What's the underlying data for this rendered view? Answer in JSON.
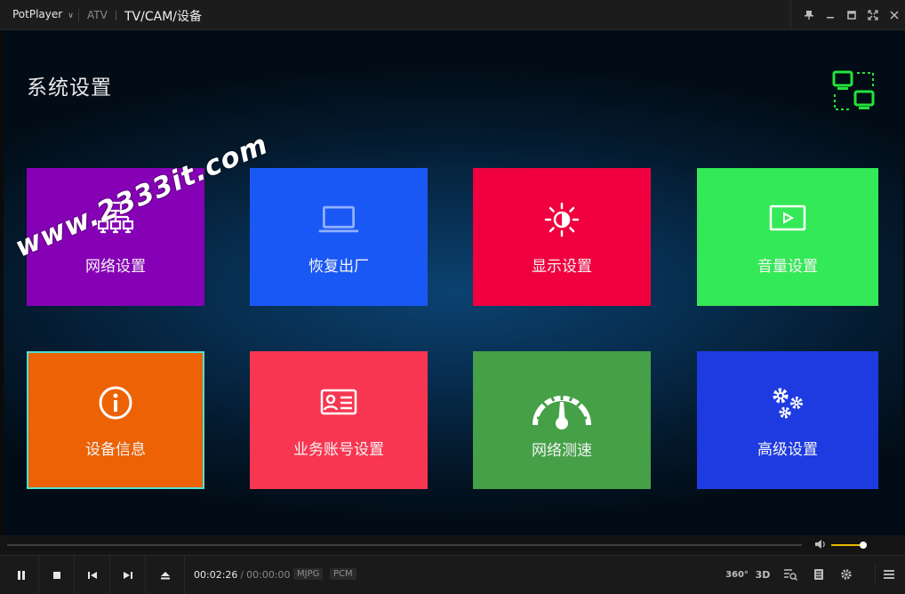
{
  "titlebar": {
    "app_menu": "PotPlayer",
    "tab_atv": "ATV",
    "title": "TV/CAM/设备",
    "controls": [
      "pin-icon",
      "minimize-icon",
      "maximize-icon",
      "fullscreen-icon",
      "close-icon"
    ]
  },
  "screen": {
    "page_title": "系统设置",
    "watermark": "www.2333it.com",
    "tiles": [
      {
        "label": "网络设置",
        "icon": "network-icon",
        "color": "#8600b6"
      },
      {
        "label": "恢复出厂",
        "icon": "laptop-icon",
        "color": "#1a58f5"
      },
      {
        "label": "显示设置",
        "icon": "brightness-icon",
        "color": "#f0003f"
      },
      {
        "label": "音量设置",
        "icon": "media-icon",
        "color": "#34e957"
      },
      {
        "label": "设备信息",
        "icon": "info-icon",
        "color": "#ec6204",
        "selected": true
      },
      {
        "label": "业务账号设置",
        "icon": "id-card-icon",
        "color": "#f83651"
      },
      {
        "label": "网络测速",
        "icon": "speedometer-icon",
        "color": "#45a047"
      },
      {
        "label": "高级设置",
        "icon": "gears-icon",
        "color": "#1e3be1"
      }
    ]
  },
  "player": {
    "current_time": "00:02:26",
    "total_time": "00:00:00",
    "video_codec": "MJPG",
    "audio_codec": "PCM",
    "volume_fraction": 0.9,
    "right_buttons": {
      "vr": "360°",
      "three_d": "3D"
    }
  }
}
